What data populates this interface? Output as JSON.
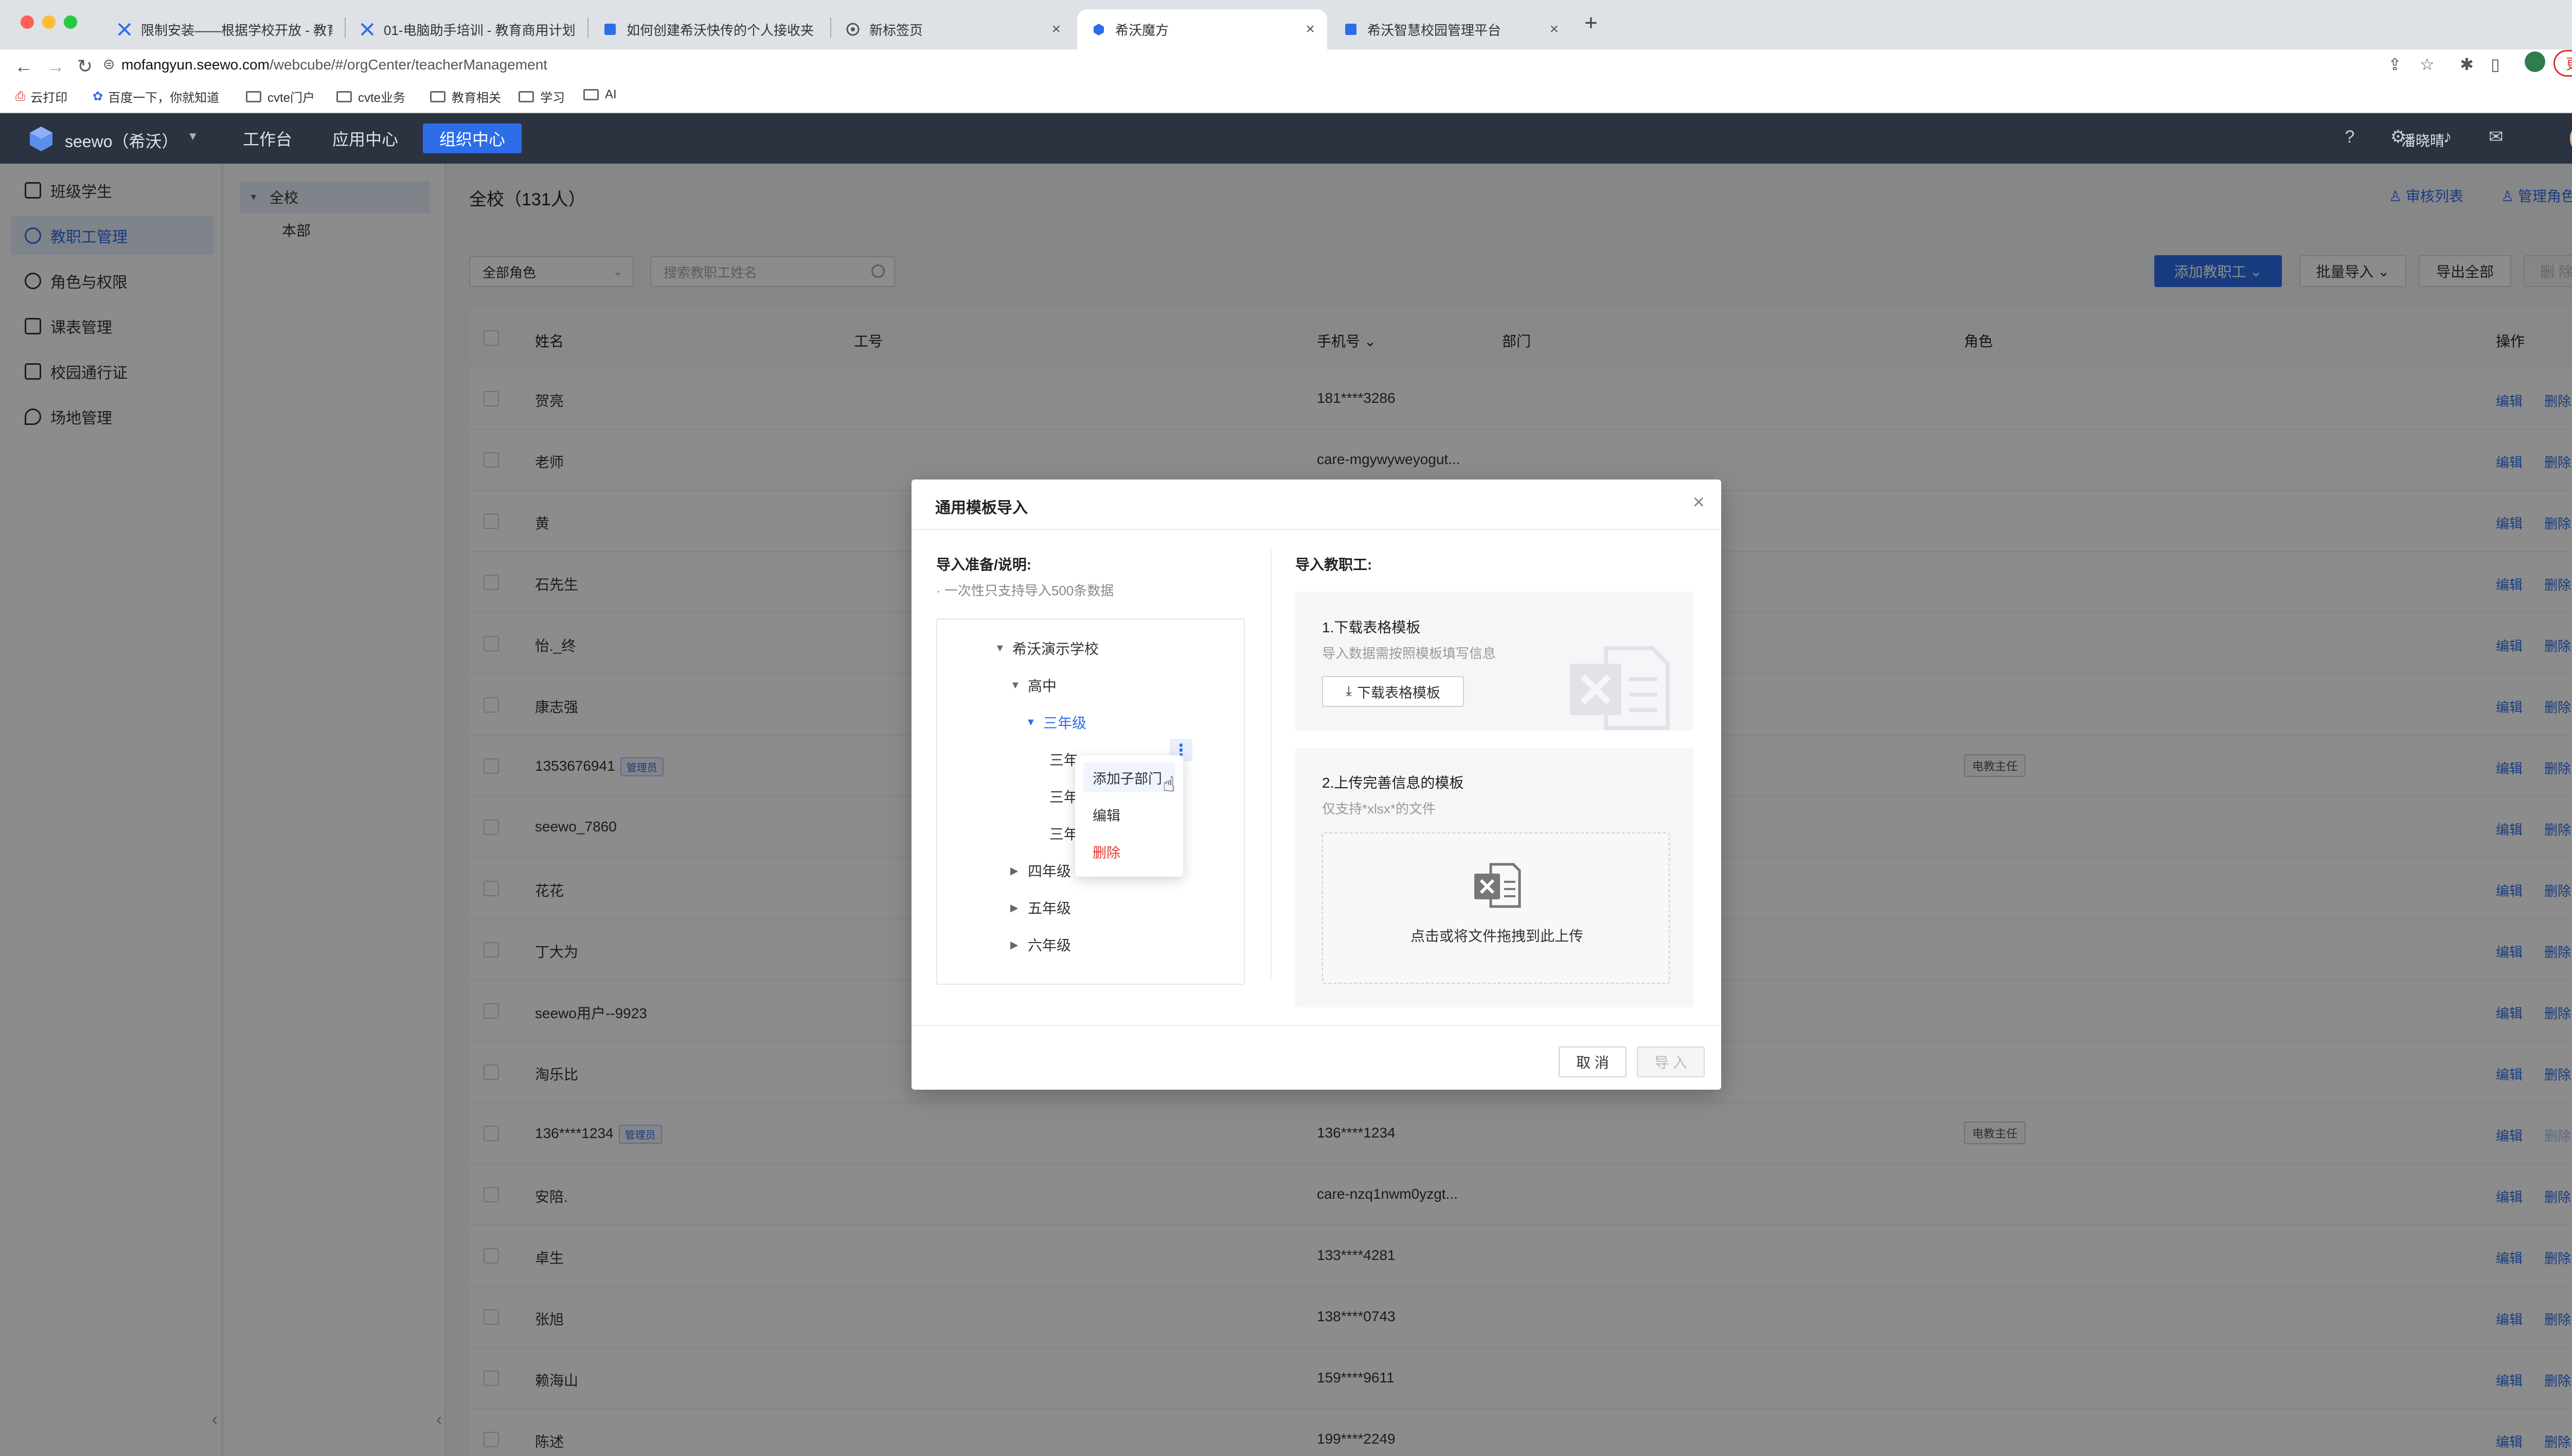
{
  "browser": {
    "tabs": [
      {
        "label": "限制安装——根据学校开放 - 教育..."
      },
      {
        "label": "01-电脑助手培训 - 教育商用计划..."
      },
      {
        "label": "如何创建希沃快传的个人接收夹"
      },
      {
        "label": "新标签页"
      },
      {
        "label": "希沃魔方"
      },
      {
        "label": "希沃智慧校园管理平台"
      }
    ],
    "url_host": "mofangyun.seewo.com",
    "url_path": "/webcube/#/orgCenter/teacherManagement",
    "update_label": "更新",
    "bookmarks": [
      "云打印",
      "百度一下，你就知道",
      "cvte门户",
      "cvte业务",
      "教育相关",
      "学习",
      "AI"
    ]
  },
  "header": {
    "brand": "seewo（希沃）",
    "nav": [
      "工作台",
      "应用中心",
      "组织中心"
    ],
    "active_nav": "组织中心",
    "user": "潘晓晴"
  },
  "sidebar": {
    "items": [
      {
        "label": "班级学生"
      },
      {
        "label": "教职工管理"
      },
      {
        "label": "角色与权限"
      },
      {
        "label": "课表管理"
      },
      {
        "label": "校园通行证"
      },
      {
        "label": "场地管理"
      }
    ]
  },
  "dept_tree": {
    "root": "全校",
    "child": "本部"
  },
  "main": {
    "title": "全校（131人）",
    "audit_link": "审核列表",
    "role_perm_link": "管理角色权限",
    "role_select": "全部角色",
    "search_placeholder": "搜索教职工姓名",
    "add_button": "添加教职工",
    "batch_button": "批量导入",
    "export_button": "导出全部",
    "delete_button": "删 除",
    "columns": [
      "姓名",
      "工号",
      "手机号",
      "部门",
      "角色",
      "操作"
    ],
    "edit_label": "编辑",
    "delete_label": "删除",
    "admin_badge": "管理员",
    "rows": [
      {
        "name": "贺亮",
        "phone": "181****3286",
        "role": "",
        "admin": false
      },
      {
        "name": "老师",
        "phone": "care-mgywyweyogut...",
        "role": "",
        "admin": false
      },
      {
        "name": "黄",
        "phone": "",
        "role": "",
        "admin": false
      },
      {
        "name": "石先生",
        "phone": "",
        "role": "",
        "admin": false
      },
      {
        "name": "怡._终",
        "phone": "",
        "role": "",
        "admin": false
      },
      {
        "name": "康志强",
        "phone": "",
        "role": "",
        "admin": false
      },
      {
        "name": "1353676941",
        "phone": "",
        "role": "电教主任",
        "admin": true
      },
      {
        "name": "seewo_7860",
        "phone": "",
        "role": "",
        "admin": false
      },
      {
        "name": "花花",
        "phone": "",
        "role": "",
        "admin": false
      },
      {
        "name": "丁大为",
        "phone": "",
        "role": "",
        "admin": false
      },
      {
        "name": "seewo用户--9923",
        "phone": "",
        "role": "",
        "admin": false
      },
      {
        "name": "淘乐比",
        "phone": "",
        "role": "",
        "admin": false
      },
      {
        "name": "136****1234",
        "phone": "136****1234",
        "role": "电教主任",
        "admin": true
      },
      {
        "name": "安陪.",
        "phone": "care-nzq1nwm0yzgt...",
        "role": "",
        "admin": false
      },
      {
        "name": "卓生",
        "phone": "133****4281",
        "role": "",
        "admin": false
      },
      {
        "name": "张旭",
        "phone": "138****0743",
        "role": "",
        "admin": false
      },
      {
        "name": "赖海山",
        "phone": "159****9611",
        "role": "",
        "admin": false
      },
      {
        "name": "陈述",
        "phone": "199****2249",
        "role": "",
        "admin": false
      }
    ]
  },
  "modal": {
    "title": "通用模板导入",
    "left_label": "导入准备/说明:",
    "left_note": "· 一次性只支持导入500条数据",
    "right_label": "导入教职工:",
    "tree": {
      "school": "希沃演示学校",
      "high": "高中",
      "grade3": "三年级",
      "sub1": "三年",
      "sub2": "三年",
      "sub3": "三年",
      "grade4": "四年级",
      "grade5": "五年级",
      "grade6": "六年级"
    },
    "context_menu": [
      "添加子部门",
      "编辑",
      "删除"
    ],
    "step1_title": "1.下载表格模板",
    "step1_note": "导入数据需按照模板填写信息",
    "download_button": "下载表格模板",
    "step2_title": "2.上传完善信息的模板",
    "step2_note": "仅支持*xlsx*的文件",
    "upload_text": "点击或将文件拖拽到此上传",
    "cancel_button": "取 消",
    "import_button": "导 入"
  },
  "colors": {
    "primary": "#2d6ee8",
    "header_bg": "#2b3340",
    "danger": "#e53935"
  }
}
